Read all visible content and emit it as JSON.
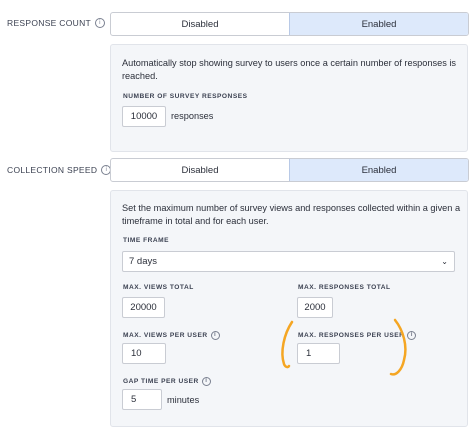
{
  "response_count": {
    "label": "RESPONSE COUNT",
    "info_icon": "info-icon",
    "options": [
      "Disabled",
      "Enabled"
    ],
    "selected": "Enabled",
    "description": "Automatically stop showing survey to users once a certain number of responses is reached.",
    "field_label": "NUMBER OF SURVEY RESPONSES",
    "field_value": "10000",
    "field_unit": "responses"
  },
  "collection_speed": {
    "label": "COLLECTION SPEED",
    "info_icon": "info-icon",
    "options": [
      "Disabled",
      "Enabled"
    ],
    "selected": "Enabled",
    "description": "Set the maximum number of survey views and responses collected within a given a timeframe in total and for each user.",
    "time_frame_label": "TIME FRAME",
    "time_frame_value": "7 days",
    "max_views_total_label": "MAX. VIEWS TOTAL",
    "max_views_total_value": "20000",
    "max_responses_total_label": "MAX. RESPONSES TOTAL",
    "max_responses_total_value": "2000",
    "max_views_per_user_label": "MAX. VIEWS PER USER",
    "max_views_per_user_value": "10",
    "max_responses_per_user_label": "MAX. RESPONSES PER USER",
    "max_responses_per_user_value": "1",
    "gap_time_label": "GAP TIME PER USER",
    "gap_time_value": "5",
    "gap_time_unit": "minutes"
  },
  "annotation_color": "#f5a623",
  "accent_color": "#dde9fb"
}
